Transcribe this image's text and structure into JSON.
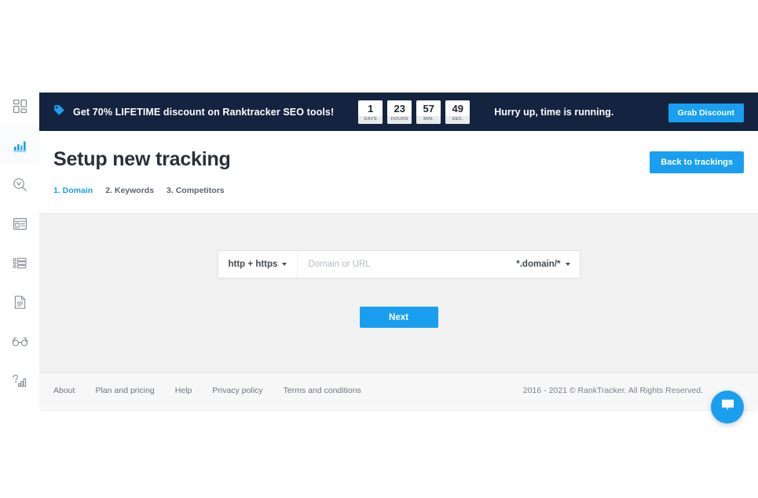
{
  "sidebar": {
    "items": [
      {
        "name": "dashboard",
        "icon": "grid-icon",
        "active": false
      },
      {
        "name": "rank-tracker",
        "icon": "bar-chart-icon",
        "active": true
      },
      {
        "name": "keyword-finder",
        "icon": "search-keyword-icon",
        "active": false
      },
      {
        "name": "serp-checker",
        "icon": "browser-card-icon",
        "active": false
      },
      {
        "name": "keyword-list",
        "icon": "list-icon",
        "active": false
      },
      {
        "name": "reports",
        "icon": "document-icon",
        "active": false
      },
      {
        "name": "spy-competitors",
        "icon": "glasses-icon",
        "active": false
      },
      {
        "name": "help-stats",
        "icon": "question-bars-icon",
        "active": false
      }
    ]
  },
  "promo": {
    "icon": "price-tag-icon",
    "message": "Get 70% LIFETIME discount on Ranktracker SEO tools!",
    "countdown": [
      {
        "value": "1",
        "label": "DAYS"
      },
      {
        "value": "23",
        "label": "HOURS"
      },
      {
        "value": "57",
        "label": "MIN."
      },
      {
        "value": "49",
        "label": "SEC."
      }
    ],
    "urgency": "Hurry up, time is running.",
    "cta_label": "Grab Discount",
    "bg_color": "#142440",
    "accent_color": "#1a9ff0"
  },
  "header": {
    "title": "Setup new tracking",
    "back_label": "Back to trackings",
    "steps": [
      {
        "label": "1. Domain",
        "active": true
      },
      {
        "label": "2. Keywords",
        "active": false
      },
      {
        "label": "3. Competitors",
        "active": false
      }
    ]
  },
  "form": {
    "protocol_value": "http + https",
    "domain_value": "",
    "domain_placeholder": "Domain or URL",
    "mask_value": "*.domain/*",
    "next_label": "Next"
  },
  "footer": {
    "links": [
      "About",
      "Plan and pricing",
      "Help",
      "Privacy policy",
      "Terms and conditions"
    ],
    "copyright": "2016 - 2021 © RankTracker. All Rights Reserved.",
    "chat_icon": "chat-bubble-icon"
  }
}
